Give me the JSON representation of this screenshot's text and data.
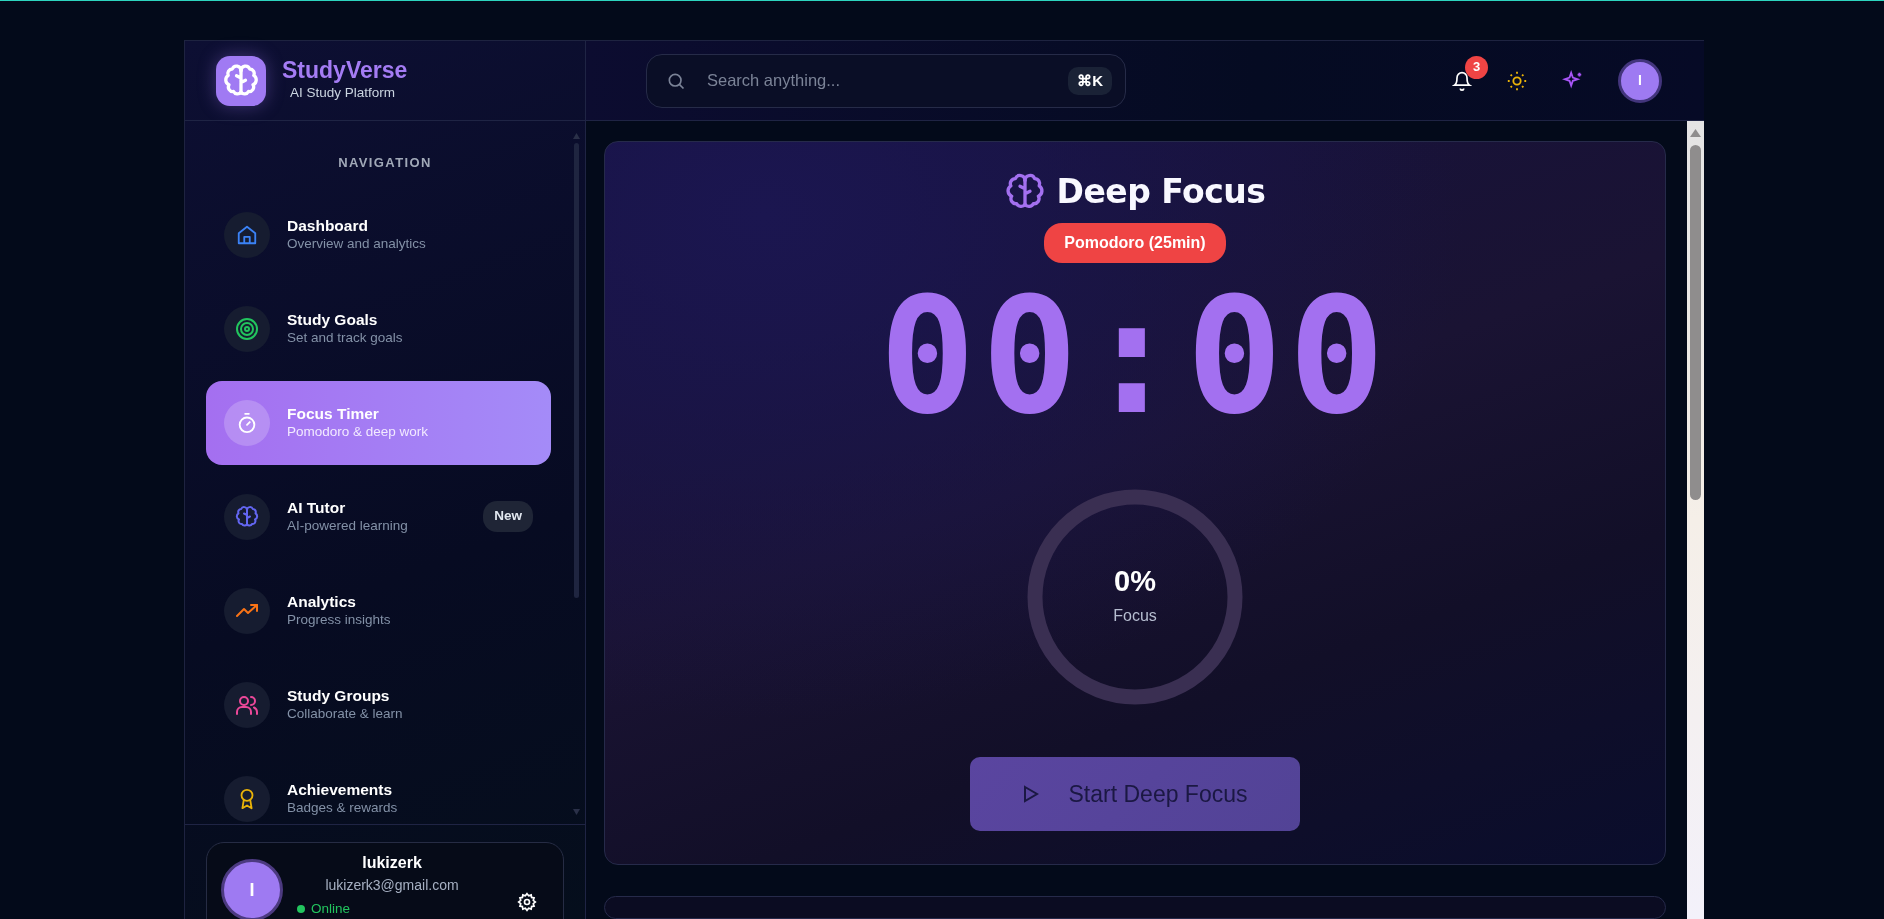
{
  "brand": {
    "name": "StudyVerse",
    "tagline": "AI Study Platform"
  },
  "sidebar": {
    "heading": "NAVIGATION",
    "items": [
      {
        "label": "Dashboard",
        "subtitle": "Overview and analytics",
        "color": "#3b82f6",
        "selected": false
      },
      {
        "label": "Study Goals",
        "subtitle": "Set and track goals",
        "color": "#22c55e",
        "selected": false
      },
      {
        "label": "Focus Timer",
        "subtitle": "Pomodoro & deep work",
        "color": "#ffffff",
        "selected": true
      },
      {
        "label": "AI Tutor",
        "subtitle": "AI-powered learning",
        "color": "#6366f1",
        "selected": false,
        "badge": "New"
      },
      {
        "label": "Analytics",
        "subtitle": "Progress insights",
        "color": "#f97316",
        "selected": false
      },
      {
        "label": "Study Groups",
        "subtitle": "Collaborate & learn",
        "color": "#ec4899",
        "selected": false
      },
      {
        "label": "Achievements",
        "subtitle": "Badges & rewards",
        "color": "#eab308",
        "selected": false
      }
    ]
  },
  "user": {
    "avatar_initial": "I",
    "name": "lukizerk",
    "email": "lukizerk3@gmail.com",
    "status": "Online",
    "online": true
  },
  "search": {
    "placeholder": "Search anything...",
    "shortcut": "⌘K"
  },
  "topbar": {
    "notification_count": "3",
    "avatar_initial": "I"
  },
  "focus": {
    "title": "Deep Focus",
    "mode": "Pomodoro (25min)",
    "time": "00:00",
    "progress": {
      "reading": "0%",
      "label": "Focus",
      "level": 0
    },
    "button": "Start Deep Focus"
  }
}
